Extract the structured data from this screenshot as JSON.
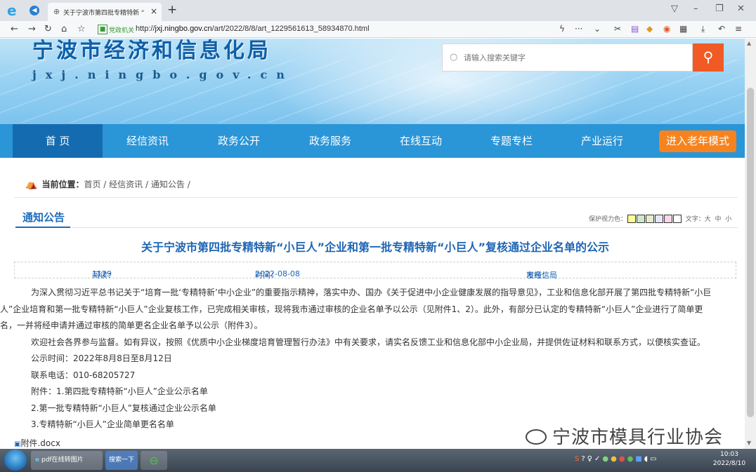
{
  "browser": {
    "tab_title": "关于宁波市第四批专精特新 “",
    "address_badge": "党政机关",
    "url_prefix": "http://",
    "url_domain": "jxj.ningbo.gov.cn",
    "url_path": "/art/2022/8/8/art_1229561613_58934870.html",
    "new_tab": "+",
    "tab_close": "×"
  },
  "site": {
    "title": "宁波市经济和信息化局",
    "domain": "jxj.ningbo.gov.cn"
  },
  "search": {
    "placeholder": "请输入搜索关键字"
  },
  "nav": {
    "items": [
      "首 页",
      "经信资讯",
      "政务公开",
      "政务服务",
      "在线互动",
      "专题专栏",
      "产业运行"
    ],
    "elder_mode": "进入老年模式"
  },
  "breadcrumb": {
    "label": "当前位置：",
    "items": [
      "首页",
      "经信资讯",
      "通知公告"
    ],
    "sep": "/"
  },
  "section": {
    "title": "通知公告",
    "eye_care_label": "保护视力色：",
    "eye_colors": [
      "#ffff99",
      "#cce8cf",
      "#e3edcd",
      "#e6e6fa",
      "#fcd6e8",
      "#ffffff"
    ],
    "font_label": "文字：",
    "font_sizes": [
      "大",
      "中",
      "小"
    ]
  },
  "article": {
    "title": "关于宁波市第四批专精特新“小巨人”企业和第一批专精特新“小巨人”复核通过企业名单的公示",
    "views_label": "阅读：",
    "views": "1129",
    "date_label": "时间：",
    "date": "2022-08-08",
    "source_label": "发布：",
    "source": "市经信局",
    "paragraphs": [
      "为深入贯彻习近平总书记关于“培育一批‘专精特新’中小企业”的重要指示精神，落实中办、国办《关于促进中小企业健康发展的指导意见》，工业和信息化部开展了第四批专精特新“小巨",
      "人”企业培育和第一批专精特新“小巨人”企业复核工作，已完成相关审核，现将我市通过审核的企业名单予以公示（见附件1、2）。此外，有部分已认定的专精特新“小巨人”企业进行了简单更",
      "名，一并将经申请并通过审核的简单更名企业名单予以公示（附件3）。",
      "欢迎社会各界参与监督。如有异议，按照《优质中小企业梯度培育管理暂行办法》中有关要求，请实名反馈工业和信息化部中小企业局，并提供佐证材料和联系方式，以便核实查证。",
      "公示时间：2022年8月8日至8月12日",
      "联系电话：010-68205727",
      "附件：1.第四批专精特新“小巨人”企业公示名单",
      "2.第一批专精特新“小巨人”复核通过企业公示名单",
      "3.专精特新“小巨人”企业简单更名名单"
    ],
    "attachment": "附件.docx"
  },
  "watermark": "宁波市模具行业协会",
  "taskbar": {
    "task1": "pdf在线转图片",
    "task2": "搜索一下",
    "clock_time": "10:03",
    "clock_date": "2022/8/10"
  }
}
